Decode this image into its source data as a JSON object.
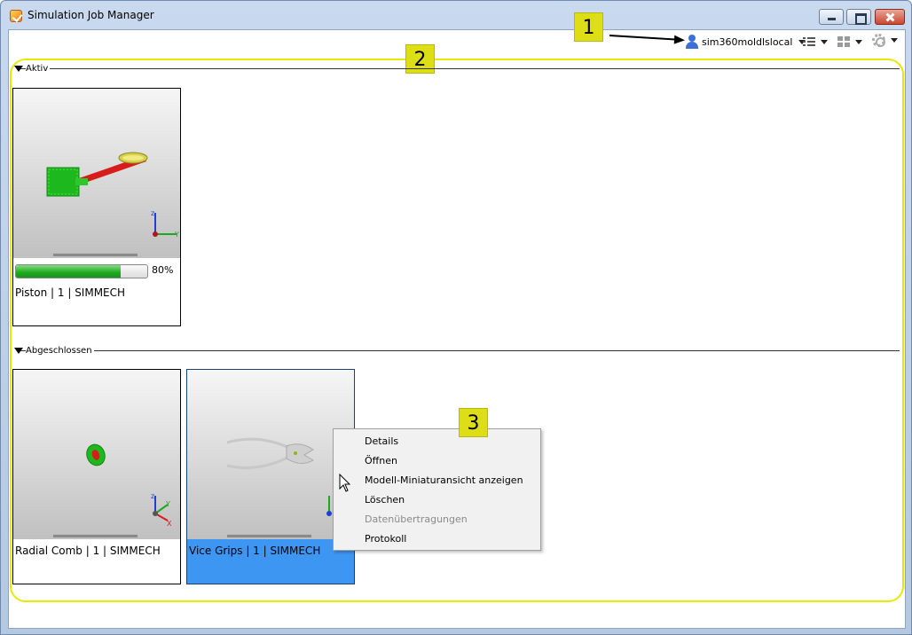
{
  "window": {
    "title": "Simulation Job Manager"
  },
  "toolbar": {
    "user_name": "sim360moldlslocal",
    "icons": [
      "user-icon",
      "list-view-icon",
      "tile-view-icon",
      "gear-icon"
    ]
  },
  "callouts": {
    "c1": "1",
    "c2": "2",
    "c3": "3"
  },
  "groups": {
    "active": {
      "label": "Aktiv",
      "jobs": [
        {
          "label": "Piston | 1 | SIMMECH",
          "progress": 0.8,
          "progress_text": "80%"
        }
      ]
    },
    "completed": {
      "label": "Abgeschlossen",
      "jobs": [
        {
          "label": "Radial Comb | 1 | SIMMECH"
        },
        {
          "label": "Vice Grips | 1 | SIMMECH",
          "selected": true
        }
      ]
    }
  },
  "context_menu": {
    "items": [
      {
        "label": "Details",
        "enabled": true
      },
      {
        "label": "Öffnen",
        "enabled": true
      },
      {
        "label": "Modell-Miniaturansicht anzeigen",
        "enabled": true
      },
      {
        "label": "Löschen",
        "enabled": true
      },
      {
        "label": "Datenübertragungen",
        "enabled": false
      },
      {
        "label": "Protokoll",
        "enabled": true
      }
    ]
  },
  "colors": {
    "callout": "#dede16",
    "highlight_frame": "#e8e800",
    "selection": "#3d96f2",
    "progress": "#1fa81f",
    "part_green": "#1db81d",
    "part_red": "#d81c1c"
  }
}
